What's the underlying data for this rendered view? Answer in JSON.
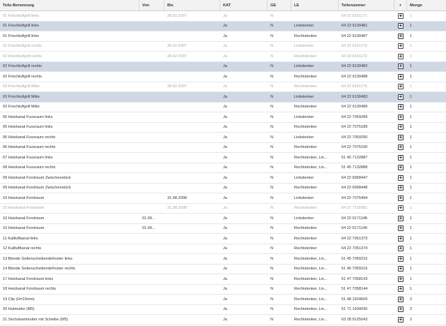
{
  "header": {
    "name": "Teile-Benennung",
    "von": "Von",
    "bis": "Bis",
    "kat": "KAT",
    "ge": "GE",
    "le": "LE",
    "teil": "Teilenummer",
    "add": "+",
    "menge": "Menge"
  },
  "add_icon_glyph": "+",
  "rows": [
    {
      "name": "01 Frischluftgrill links",
      "von": "",
      "bis": "28.02.2007",
      "kat": "Ja",
      "ge": "N",
      "le": "",
      "teil": "64 22 8151171",
      "menge": "1",
      "state": "grey"
    },
    {
      "name": "01 Frischluftgrill links",
      "von": "",
      "bis": "",
      "kat": "Ja",
      "ge": "N",
      "le": "Linkslenker",
      "teil": "64 22 9130481",
      "menge": "1",
      "state": "selected"
    },
    {
      "name": "01 Frischluftgrill links",
      "von": "",
      "bis": "",
      "kat": "Ja",
      "ge": "N",
      "le": "Rechtslenker",
      "teil": "64 22 9130487",
      "menge": "1",
      "state": ""
    },
    {
      "name": "02 Frischluftgrill rechts",
      "von": "",
      "bis": "28.02.2007",
      "kat": "Ja",
      "ge": "N",
      "le": "Linkslenker",
      "teil": "64 22 8151170",
      "menge": "1",
      "state": "grey"
    },
    {
      "name": "02 Frischluftgrill rechts",
      "von": "",
      "bis": "28.02.2007",
      "kat": "Ja",
      "ge": "N",
      "le": "Rechtslenker",
      "teil": "64 22 8151172",
      "menge": "1",
      "state": "grey"
    },
    {
      "name": "02 Frischluftgrill rechts",
      "von": "",
      "bis": "",
      "kat": "Ja",
      "ge": "N",
      "le": "Linkslenker",
      "teil": "64 22 9130482",
      "menge": "1",
      "state": "selected"
    },
    {
      "name": "02 Frischluftgrill rechts",
      "von": "",
      "bis": "",
      "kat": "Ja",
      "ge": "N",
      "le": "Rechtslenker",
      "teil": "64 22 9130488",
      "menge": "1",
      "state": ""
    },
    {
      "name": "03 Frischluftgrill Mitte",
      "von": "",
      "bis": "28.02.2007",
      "kat": "Ja",
      "ge": "N",
      "le": "Rechtslenker",
      "teil": "64 22 8151175",
      "menge": "1",
      "state": "grey"
    },
    {
      "name": "03 Frischluftgrill Mitte",
      "von": "",
      "bis": "",
      "kat": "Ja",
      "ge": "N",
      "le": "Linkslenker",
      "teil": "64 22 9130483",
      "menge": "1",
      "state": "selected"
    },
    {
      "name": "03 Frischluftgrill Mitte",
      "von": "",
      "bis": "",
      "kat": "Ja",
      "ge": "N",
      "le": "Rechtslenker",
      "teil": "64 22 9130489",
      "menge": "1",
      "state": ""
    },
    {
      "name": "05 Heizkanal Fussraum links",
      "von": "",
      "bis": "",
      "kat": "Ja",
      "ge": "N",
      "le": "Linkslenker",
      "teil": "64 22 7059289",
      "menge": "1",
      "state": ""
    },
    {
      "name": "05 Heizkanal Fussraum links",
      "von": "",
      "bis": "",
      "kat": "Ja",
      "ge": "N",
      "le": "Rechtslenker",
      "teil": "64 22 7075189",
      "menge": "1",
      "state": ""
    },
    {
      "name": "06 Heizkanal Fussraum rechts",
      "von": "",
      "bis": "",
      "kat": "Ja",
      "ge": "N",
      "le": "Linkslenker",
      "teil": "64 22 7059290",
      "menge": "1",
      "state": ""
    },
    {
      "name": "06 Heizkanal Fussraum rechts",
      "von": "",
      "bis": "",
      "kat": "Ja",
      "ge": "N",
      "le": "Rechtslenker",
      "teil": "64 22 7075190",
      "menge": "1",
      "state": ""
    },
    {
      "name": "07 Heizkanal Fussraum links",
      "von": "",
      "bis": "",
      "kat": "Ja",
      "ge": "N",
      "le": "Rechtslenker, Lin...",
      "teil": "51 45 7132887",
      "menge": "1",
      "state": ""
    },
    {
      "name": "08 Heizkanal Fussraum rechts",
      "von": "",
      "bis": "",
      "kat": "Ja",
      "ge": "N",
      "le": "Rechtslenker, Lin...",
      "teil": "51 45 7132888",
      "menge": "1",
      "state": ""
    },
    {
      "name": "09 Heizkanal Fondraum Zwischenstück",
      "von": "",
      "bis": "",
      "kat": "Ja",
      "ge": "N",
      "le": "Linkslenker",
      "teil": "64 22 6968447",
      "menge": "1",
      "state": ""
    },
    {
      "name": "09 Heizkanal Fondraum Zwischenstück",
      "von": "",
      "bis": "",
      "kat": "Ja",
      "ge": "N",
      "le": "Rechtslenker",
      "teil": "64 22 6968448",
      "menge": "1",
      "state": ""
    },
    {
      "name": "10 Heizkanal Fondraum",
      "von": "",
      "bis": "31.08.2008",
      "kat": "Ja",
      "ge": "N",
      "le": "Linkslenker",
      "teil": "64 22 7075494",
      "menge": "1",
      "state": ""
    },
    {
      "name": "10 Heizkanal Fondraum",
      "von": "",
      "bis": "31.08.2008",
      "kat": "Ja",
      "ge": "N",
      "le": "Rechtslenker",
      "teil": "64 22 7118081",
      "menge": "1",
      "state": "grey"
    },
    {
      "name": "10 Heizkanal Fondraum",
      "von": "01.09...",
      "bis": "",
      "kat": "Ja",
      "ge": "N",
      "le": "Linkslenker",
      "teil": "64 22 9171148",
      "menge": "1",
      "state": ""
    },
    {
      "name": "10 Heizkanal Fondraum",
      "von": "01.09...",
      "bis": "",
      "kat": "Ja",
      "ge": "N",
      "le": "Rechtslenker",
      "teil": "64 22 9171149",
      "menge": "1",
      "state": ""
    },
    {
      "name": "11 Kaltluftkanal links",
      "von": "",
      "bis": "",
      "kat": "Ja",
      "ge": "N",
      "le": "Rechtslenker",
      "teil": "64 22 7051373",
      "menge": "1",
      "state": ""
    },
    {
      "name": "12 Kaltluftkanal rechts",
      "von": "",
      "bis": "",
      "kat": "Ja",
      "ge": "N",
      "le": "Rechtslenker",
      "teil": "64 22 7051374",
      "menge": "1",
      "state": ""
    },
    {
      "name": "13 Blende Seitenscheibendefroster links",
      "von": "",
      "bis": "",
      "kat": "Ja",
      "ge": "N",
      "le": "Rechtslenker, Lin...",
      "teil": "51 45 7059215",
      "menge": "1",
      "state": ""
    },
    {
      "name": "14 Blende Seitenscheibendefroster rechts",
      "von": "",
      "bis": "",
      "kat": "Ja",
      "ge": "N",
      "le": "Rechtslenker, Lin...",
      "teil": "51 45 7059216",
      "menge": "1",
      "state": ""
    },
    {
      "name": "17 Heizkanal Fondraum links",
      "von": "",
      "bis": "",
      "kat": "Ja",
      "ge": "N",
      "le": "Rechtslenker, Lin...",
      "teil": "51 47 7058143",
      "menge": "1",
      "state": ""
    },
    {
      "name": "18 Heizkanal Fondraum rechts",
      "von": "",
      "bis": "",
      "kat": "Ja",
      "ge": "N",
      "le": "Rechtslenker, Lin...",
      "teil": "51 47 7058144",
      "menge": "1",
      "state": ""
    },
    {
      "name": "19 Clip (H=15mm)",
      "von": "",
      "bis": "",
      "kat": "Ja",
      "ge": "N",
      "le": "Rechtslenker, Lin...",
      "teil": "51 48 1924609",
      "menge": "2",
      "state": ""
    },
    {
      "name": "20 Hutmutter (M5)",
      "von": "",
      "bis": "",
      "kat": "Ja",
      "ge": "N",
      "le": "Rechtslenker, Lin...",
      "teil": "51 71 1934030",
      "menge": "3",
      "state": ""
    },
    {
      "name": "21 Sechskantmutter mit Scheibe (M5)",
      "von": "",
      "bis": "",
      "kat": "Ja",
      "ge": "N",
      "le": "Rechtslenker, Lin...",
      "teil": "63 28 9125043",
      "menge": "2",
      "state": ""
    }
  ]
}
